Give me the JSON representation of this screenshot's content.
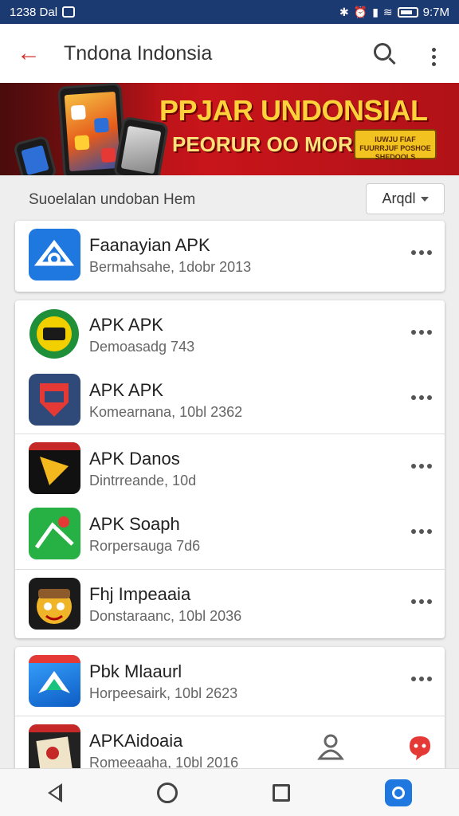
{
  "status_bar": {
    "time_left": "1238 Dal",
    "time_right": "9:7M"
  },
  "app_bar": {
    "title": "Tndona Indonsia"
  },
  "banner": {
    "headline": "PPJAR UNDONSIAL",
    "subline": "PEORUR OO MORRAN!",
    "cta_text": "IUWJU FIAF FUURRJUF POSHOE SHEDOOLS"
  },
  "filter": {
    "label": "Suoelalan undoban Hem",
    "sort_label": "Arqdl"
  },
  "apps": [
    {
      "name": "Faanayian APK",
      "sub": "Bermahsahe, 1dobr 2013",
      "icon": "shield-a-icon"
    },
    {
      "name": "APK APK",
      "sub": "Demoasadg 743",
      "icon": "green-badge-icon"
    },
    {
      "name": "APK APK",
      "sub": "Komearnana, 10bl 2362",
      "icon": "red-shield-icon"
    },
    {
      "name": "APK Danos",
      "sub": "Dintrreande, 10d",
      "icon": "yellow-arrow-icon"
    },
    {
      "name": "APK Soaph",
      "sub": "Rorpersauga 7d6",
      "icon": "green-map-icon"
    },
    {
      "name": "Fhj Impeaaia",
      "sub": "Donstaraanc, 10bl 2036",
      "icon": "cartoon-face-icon"
    },
    {
      "name": "Pbk Mlaaurl",
      "sub": "Horpeesairk, 10bl 2623",
      "icon": "blue-arrow-icon"
    },
    {
      "name": "APKAidoaia",
      "sub": "Romeeaaha, 10bl 2016",
      "icon": "dark-card-icon"
    }
  ],
  "colors": {
    "status_bar": "#1c3a72",
    "accent": "#d32f2f",
    "banner_red": "#c8151b",
    "banner_yellow": "#ffd23b"
  }
}
